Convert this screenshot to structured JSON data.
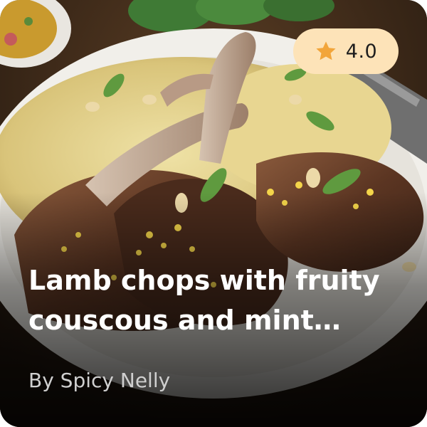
{
  "card": {
    "title": "Lamb chops with fruity couscous and mint…",
    "author": "By Spicy Nelly",
    "rating": {
      "icon": "star-icon",
      "value": "4.0",
      "badge_color": "#fde3b8",
      "star_color": "#f2a53a"
    }
  }
}
